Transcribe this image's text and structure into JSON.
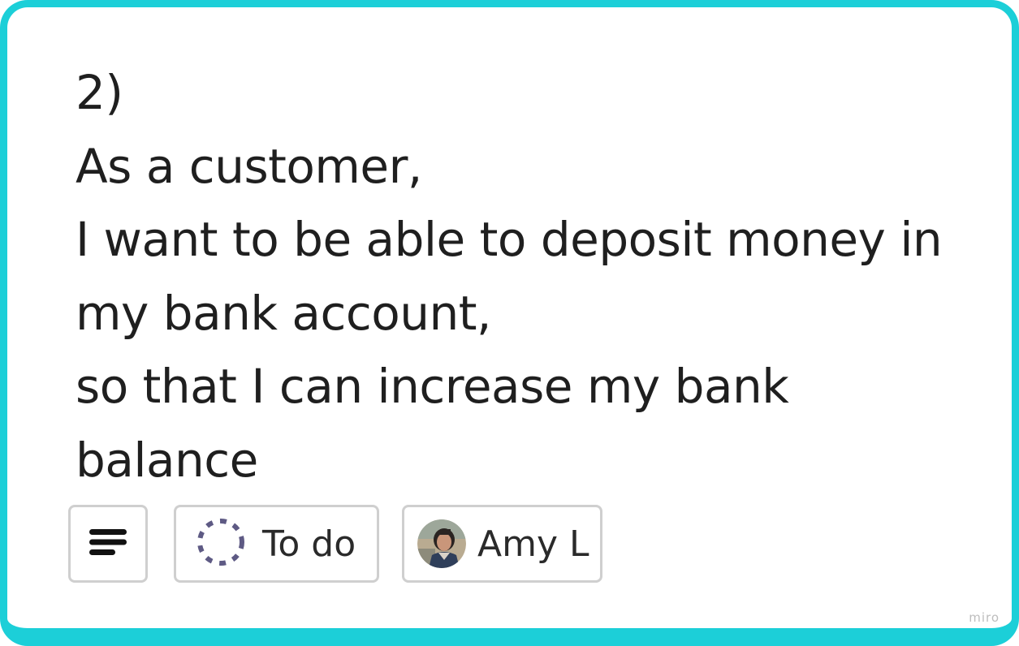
{
  "card": {
    "border_color": "#1ccfd8",
    "lines": [
      "2)",
      "As a customer,",
      "I want to be able to deposit money in",
      "my bank account,",
      "so that I can increase my bank",
      "balance"
    ]
  },
  "chips": {
    "description_icon": "text-lines-icon",
    "status": {
      "icon": "dashed-circle-icon",
      "label": "To do"
    },
    "assignee": {
      "avatar": "user-avatar",
      "name": "Amy L"
    }
  },
  "watermark": "miro"
}
